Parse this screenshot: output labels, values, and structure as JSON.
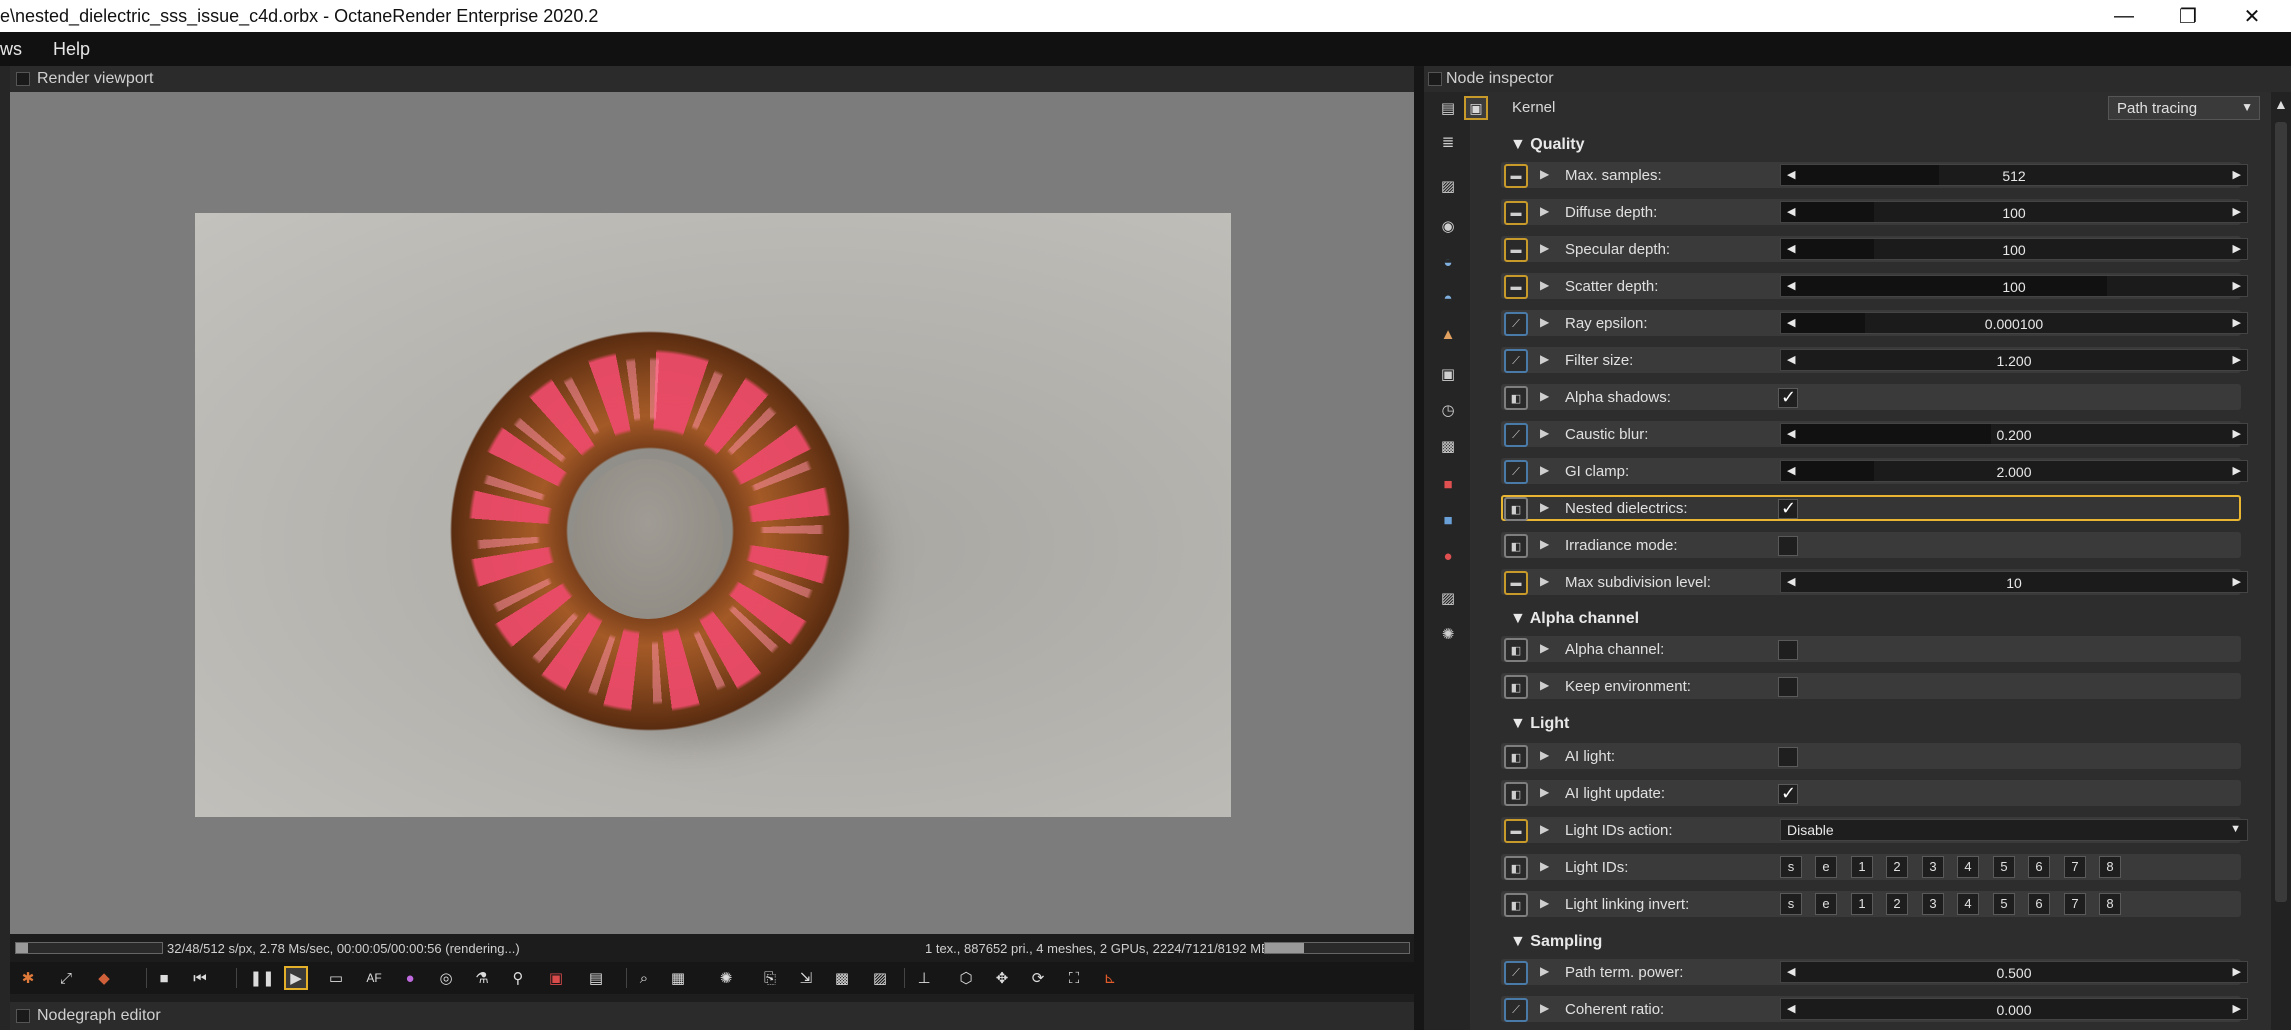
{
  "window": {
    "title": "e\\nested_dielectric_sss_issue_c4d.orbx - OctaneRender Enterprise 2020.2",
    "controls": {
      "minimize": "—",
      "restore": "❐",
      "close": "✕"
    }
  },
  "menubar": {
    "items": [
      "ws",
      "Help"
    ]
  },
  "render_viewport": {
    "title": "Render viewport",
    "status_left": "32/48/512 s/px, 2.78 Ms/sec, 00:00:05/00:00:56 (rendering...)",
    "status_right": "1 tex., 887652 pri., 4 meshes, 2 GPUs, 2224/7121/8192 MB",
    "progress": 0.08,
    "memory_usage": 0.27
  },
  "toolbar": {
    "icons": [
      "reset-icon",
      "recenter-icon",
      "cube-color-icon",
      "stop-icon",
      "restart-icon",
      "pause-icon",
      "play-icon",
      "display-icon",
      "af-icon",
      "color-picker-icon",
      "focus-icon",
      "material-picker-icon",
      "object-picker-icon",
      "region-icon",
      "camera-icon",
      "zoom-region-icon",
      "film-region-icon",
      "light-icon",
      "copy-icon",
      "export-icon",
      "save-icon",
      "lock-icon",
      "cube-icon",
      "move-icon",
      "rotate-icon",
      "fit-icon",
      "axis-icon"
    ],
    "af_label": "AF"
  },
  "nodegraph": {
    "title": "Nodegraph editor"
  },
  "inspector": {
    "title": "Node inspector",
    "kernel": {
      "label": "Kernel",
      "value": "Path tracing"
    },
    "sections": {
      "quality": "Quality",
      "alpha": "Alpha channel",
      "light": "Light",
      "sampling": "Sampling"
    },
    "rows": {
      "max_samples": {
        "label": "Max. samples:",
        "value": "512",
        "fill": 0.34
      },
      "diffuse_depth": {
        "label": "Diffuse depth:",
        "value": "100",
        "fill": 0.2
      },
      "specular_depth": {
        "label": "Specular depth:",
        "value": "100",
        "fill": 0.2
      },
      "scatter_depth": {
        "label": "Scatter depth:",
        "value": "100",
        "fill": 0.7
      },
      "ray_epsilon": {
        "label": "Ray epsilon:",
        "value": "0.000100",
        "fill": 0.18
      },
      "filter_size": {
        "label": "Filter size:",
        "value": "1.200",
        "fill": 0.0
      },
      "alpha_shadows": {
        "label": "Alpha shadows:",
        "checked": true
      },
      "caustic_blur": {
        "label": "Caustic blur:",
        "value": "0.200",
        "fill": 0.45
      },
      "gi_clamp": {
        "label": "GI clamp:",
        "value": "2.000",
        "fill": 0.2
      },
      "nested_dielectrics": {
        "label": "Nested dielectrics:",
        "checked": true
      },
      "irradiance_mode": {
        "label": "Irradiance mode:",
        "checked": false
      },
      "max_subdivision": {
        "label": "Max subdivision level:",
        "value": "10",
        "fill": 0.0
      },
      "alpha_channel": {
        "label": "Alpha channel:",
        "checked": false
      },
      "keep_environment": {
        "label": "Keep environment:",
        "checked": false
      },
      "ai_light": {
        "label": "AI light:",
        "checked": false
      },
      "ai_light_update": {
        "label": "AI light update:",
        "checked": true
      },
      "light_ids_action": {
        "label": "Light IDs action:",
        "value": "Disable"
      },
      "light_ids": {
        "label": "Light IDs:",
        "buttons": [
          "s",
          "e",
          "1",
          "2",
          "3",
          "4",
          "5",
          "6",
          "7",
          "8"
        ]
      },
      "light_linking_invert": {
        "label": "Light linking invert:",
        "buttons": [
          "s",
          "e",
          "1",
          "2",
          "3",
          "4",
          "5",
          "6",
          "7",
          "8"
        ]
      },
      "path_term_power": {
        "label": "Path term. power:",
        "value": "0.500",
        "fill": 0.0
      },
      "coherent_ratio": {
        "label": "Coherent ratio:",
        "value": "0.000",
        "fill": 0.0
      }
    }
  },
  "colors": {
    "highlight": "#e8b630",
    "accent_yellow": "#c89a2a",
    "accent_blue": "#4a7aa8"
  }
}
